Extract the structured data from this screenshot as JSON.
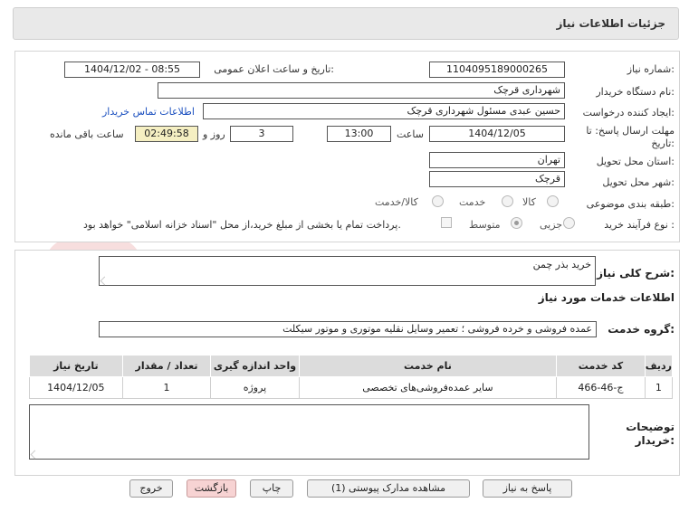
{
  "header": {
    "title": "جزئیات اطلاعات نیاز"
  },
  "form": {
    "need_number_label": "شماره نیاز:",
    "need_number": "1104095189000265",
    "announce_label": "تاریخ و ساعت اعلان عمومی:",
    "announce_value": "1404/12/02 - 08:55",
    "buyer_org_label": "نام دستگاه خریدار:",
    "buyer_org": "شهرداری قرچک",
    "creator_label": "ایجاد کننده درخواست:",
    "creator": "حسین عبدی مسئول شهرداری قرچک",
    "contact_link": "اطلاعات تماس خریدار",
    "deadline_label_line1": "مهلت ارسال پاسخ: تا",
    "deadline_label_line2": "تاریخ:",
    "deadline_date": "1404/12/05",
    "time_label": "ساعت",
    "deadline_time": "13:00",
    "days_value": "3",
    "days_label": "روز و",
    "remaining_time": "02:49:58",
    "remaining_label": "ساعت باقی مانده",
    "province_label": "استان محل تحویل:",
    "province": "تهران",
    "city_label": "شهر محل تحویل:",
    "city": "قرچک",
    "category_label": "طبقه بندی موضوعی:",
    "category_options": [
      "کالا",
      "خدمت",
      "کالا/خدمت"
    ],
    "purchase_type_label": "نوع فرآیند خرید :",
    "purchase_type_options": [
      "جزیی",
      "متوسط"
    ],
    "payment_note": "پرداخت تمام یا بخشی از مبلغ خرید،از محل \"اسناد خزانه اسلامی\" خواهد بود."
  },
  "details": {
    "general_desc_label": "شرح کلی نیاز:",
    "general_desc": "خرید بذر چمن",
    "services_info_title": "اطلاعات خدمات مورد نیاز",
    "service_group_label": "گروه خدمت:",
    "service_group": "عمده فروشی و خرده فروشی ؛ تعمیر وسایل نقلیه موتوری و موتور سیکلت",
    "table": {
      "headers": [
        "ردیف",
        "کد خدمت",
        "نام خدمت",
        "واحد اندازه گیری",
        "تعداد / مقدار",
        "تاریخ نیاز"
      ],
      "rows": [
        [
          "1",
          "ج-46-466",
          "سایر عمده‌فروشی‌های تخصصی",
          "پروژه",
          "1",
          "1404/12/05"
        ]
      ]
    },
    "buyer_notes_label_line1": "توضیحات",
    "buyer_notes_label_line2": "خریدار:",
    "buyer_notes": ""
  },
  "buttons": {
    "reply": "پاسخ به نیاز",
    "attachments": "مشاهده مدارک پیوستی (1)",
    "print": "چاپ",
    "back": "بازگشت",
    "exit": "خروج"
  }
}
